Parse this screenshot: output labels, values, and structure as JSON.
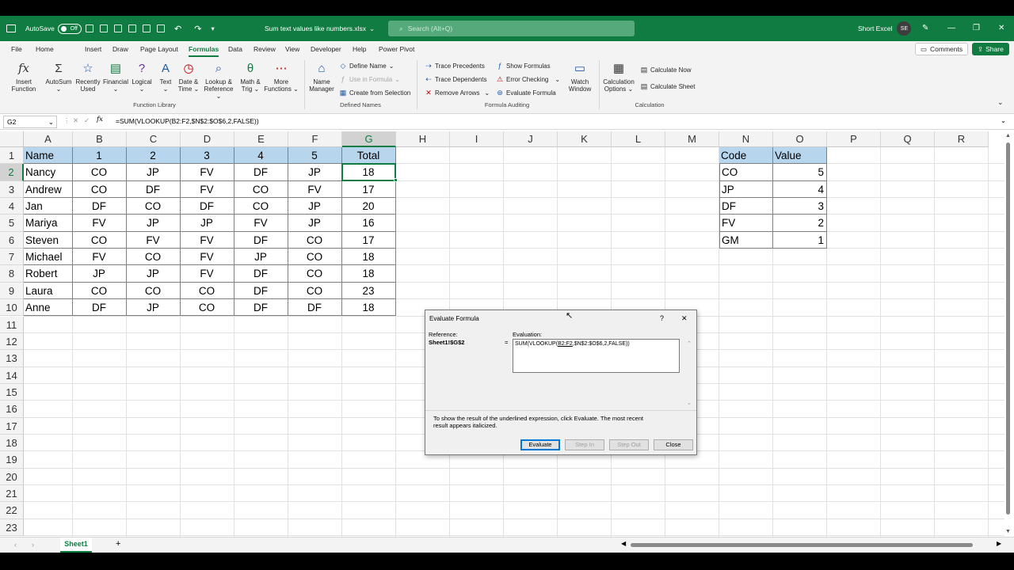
{
  "titlebar": {
    "autosave_label": "AutoSave",
    "autosave_state": "Off",
    "filename": "Sum text values like numbers.xlsx",
    "search_placeholder": "Search (Alt+Q)",
    "user_name": "Short Excel",
    "user_initials": "SE"
  },
  "menu": {
    "tabs": [
      "File",
      "Home",
      "Insert",
      "Draw",
      "Page Layout",
      "Formulas",
      "Data",
      "Review",
      "View",
      "Developer",
      "Help",
      "Power Pivot"
    ],
    "comments": "Comments",
    "share": "Share"
  },
  "ribbon": {
    "insert_function": [
      "Insert",
      "Function"
    ],
    "autosum": "AutoSum",
    "recently_used": [
      "Recently",
      "Used"
    ],
    "financial": "Financial",
    "logical": "Logical",
    "text": "Text",
    "date_time": [
      "Date &",
      "Time"
    ],
    "lookup": [
      "Lookup &",
      "Reference"
    ],
    "math": [
      "Math &",
      "Trig"
    ],
    "more": [
      "More",
      "Functions"
    ],
    "function_library": "Function Library",
    "name_manager": [
      "Name",
      "Manager"
    ],
    "define_name": "Define Name",
    "use_in_formula": "Use in Formula",
    "create_from_selection": "Create from Selection",
    "defined_names": "Defined Names",
    "trace_precedents": "Trace Precedents",
    "trace_dependents": "Trace Dependents",
    "remove_arrows": "Remove Arrows",
    "show_formulas": "Show Formulas",
    "error_checking": "Error Checking",
    "evaluate_formula": "Evaluate Formula",
    "formula_auditing": "Formula Auditing",
    "watch_window": [
      "Watch",
      "Window"
    ],
    "calculation_options": [
      "Calculation",
      "Options"
    ],
    "calculate_now": "Calculate Now",
    "calculate_sheet": "Calculate Sheet",
    "calculation": "Calculation"
  },
  "formula_bar": {
    "name_box": "G2",
    "fx": "fx",
    "formula": "=SUM(VLOOKUP(B2:F2,$N$2:$O$6,2,FALSE))"
  },
  "sheet": {
    "columns": [
      "A",
      "B",
      "C",
      "D",
      "E",
      "F",
      "G",
      "H",
      "I",
      "J",
      "K",
      "L",
      "M",
      "N",
      "O",
      "P",
      "Q",
      "R"
    ],
    "rows": [
      "1",
      "2",
      "3",
      "4",
      "5",
      "6",
      "7",
      "8",
      "9",
      "10",
      "11",
      "12",
      "13",
      "14",
      "15",
      "16",
      "17",
      "18",
      "19",
      "20",
      "21",
      "22",
      "23"
    ],
    "main_header": [
      "Name",
      "1",
      "2",
      "3",
      "4",
      "5",
      "Total"
    ],
    "main_rows": [
      [
        "Nancy",
        "CO",
        "JP",
        "FV",
        "DF",
        "JP",
        "18"
      ],
      [
        "Andrew",
        "CO",
        "DF",
        "FV",
        "CO",
        "FV",
        "17"
      ],
      [
        "Jan",
        "DF",
        "CO",
        "DF",
        "CO",
        "JP",
        "20"
      ],
      [
        "Mariya",
        "FV",
        "JP",
        "JP",
        "FV",
        "JP",
        "16"
      ],
      [
        "Steven",
        "CO",
        "FV",
        "FV",
        "DF",
        "CO",
        "17"
      ],
      [
        "Michael",
        "FV",
        "CO",
        "FV",
        "JP",
        "CO",
        "18"
      ],
      [
        "Robert",
        "JP",
        "JP",
        "FV",
        "DF",
        "CO",
        "18"
      ],
      [
        "Laura",
        "CO",
        "CO",
        "CO",
        "DF",
        "CO",
        "23"
      ],
      [
        "Anne",
        "DF",
        "JP",
        "CO",
        "DF",
        "DF",
        "18"
      ]
    ],
    "lookup_header": [
      "Code",
      "Value"
    ],
    "lookup_rows": [
      [
        "CO",
        "5"
      ],
      [
        "JP",
        "4"
      ],
      [
        "DF",
        "3"
      ],
      [
        "FV",
        "2"
      ],
      [
        "GM",
        "1"
      ]
    ],
    "header_fill": "#b7d6ed",
    "accent": "#107c41"
  },
  "dialog": {
    "title": "Evaluate Formula",
    "help": "?",
    "close": "✕",
    "reference_label": "Reference:",
    "reference_value": "Sheet1!$G$2",
    "equals": "=",
    "evaluation_label": "Evaluation:",
    "eval_prefix": "SUM(VLOOKUP(",
    "eval_underlined": "B2:F2",
    "eval_suffix": ",$N$2:$O$6,2,FALSE))",
    "hint_line1": "To show the result of the underlined expression, click Evaluate.  The most recent",
    "hint_line2": "result appears italicized.",
    "btn_evaluate": "Evaluate",
    "btn_step_in": "Step In",
    "btn_step_out": "Step Out",
    "btn_close": "Close"
  },
  "sheet_tabs": {
    "active": "Sheet1",
    "add": "+"
  }
}
